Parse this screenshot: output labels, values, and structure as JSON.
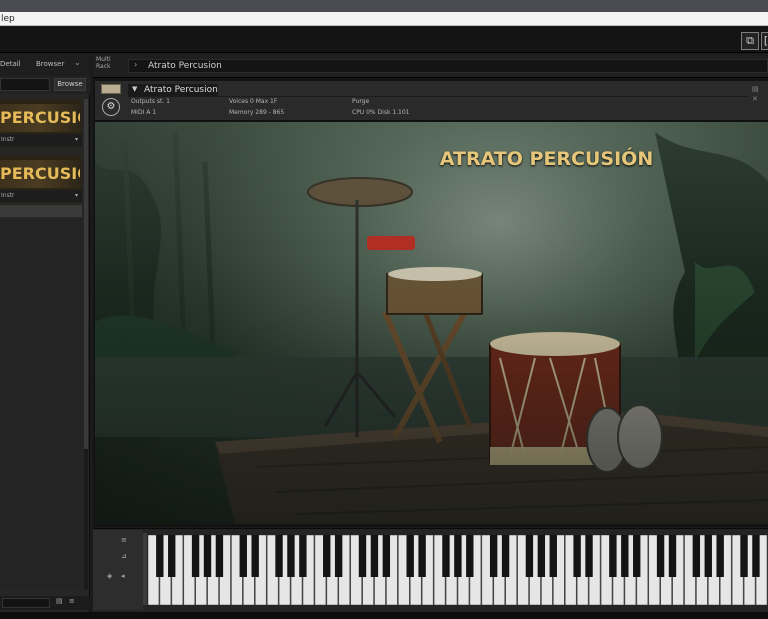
{
  "window": {
    "menu_text": "lep"
  },
  "toolbar": {
    "right_button_1": "⧉",
    "right_button_2": "["
  },
  "browser": {
    "tab_1": "Detail",
    "tab_2": "Browser",
    "browse_button": "Browse",
    "libraries": [
      {
        "title": "PERCUSIÓN",
        "subtitle": "Instr"
      },
      {
        "title": "PERCUSIÓN",
        "subtitle": "Instr"
      }
    ],
    "bottom_icons": "▤ ≡"
  },
  "rack": {
    "label": "Multi Rack",
    "title": "Atrato Percusion"
  },
  "instrument": {
    "name": "Atrato Percusion",
    "outputs": "Outputs  st. 1",
    "midi": "MIDI  A  1",
    "voices": "Voices  0  Max 1F",
    "memory": "Memory  289 - 865",
    "purge": "Purge",
    "cpu": "CPU  0%  Disk  1.101",
    "artwork_title": "ATRATO PERCUSIÓN"
  },
  "keyboard": {
    "white_keys": 52,
    "controls": [
      "≡",
      "⊿",
      "◈",
      "◂"
    ]
  }
}
